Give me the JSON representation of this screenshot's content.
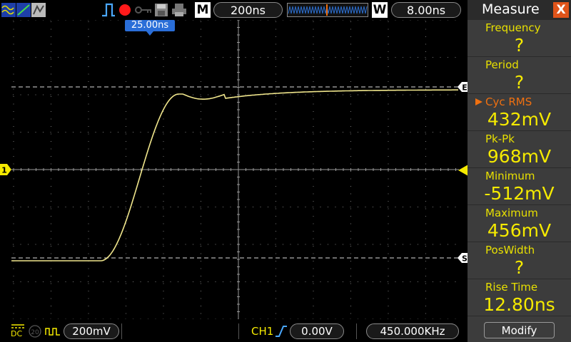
{
  "top_bar": {
    "mode_label": "M",
    "timebase": "200ns",
    "window_label": "W",
    "window_timebase": "8.00ns"
  },
  "trigger_position": "25.00ns",
  "markers": {
    "channel1": "1",
    "cursor_e": "E",
    "cursor_s": "S"
  },
  "bottom_bar": {
    "coupling": "DC",
    "bw_label": "20",
    "volts_div": "200mV",
    "trigger_channel": "CH1",
    "trigger_level": "0.00V",
    "frequency": "450.000KHz"
  },
  "panel": {
    "title": "Measure",
    "close": "X",
    "items": [
      {
        "label": "Frequency",
        "value": "?",
        "selected": false
      },
      {
        "label": "Period",
        "value": "?",
        "selected": false
      },
      {
        "label": "Cyc RMS",
        "value": "432mV",
        "selected": true
      },
      {
        "label": "Pk-Pk",
        "value": "968mV",
        "selected": false
      },
      {
        "label": "Minimum",
        "value": "-512mV",
        "selected": false
      },
      {
        "label": "Maximum",
        "value": "456mV",
        "selected": false
      },
      {
        "label": "PosWidth",
        "value": "?",
        "selected": false
      },
      {
        "label": "Rise Time",
        "value": "12.80ns",
        "selected": false
      }
    ],
    "modify_label": "Modify"
  },
  "colors": {
    "trace": "#f0e68c",
    "accent": "#e8e000",
    "panel_bg": "#3c3c3c",
    "close_bg": "#e0541a",
    "trigger_tag": "#2a6ed8",
    "run_indicator": "#ff1a1a"
  }
}
